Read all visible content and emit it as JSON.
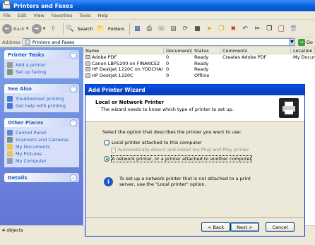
{
  "window": {
    "title": "Printers and Faxes"
  },
  "menu": [
    "File",
    "Edit",
    "View",
    "Favorites",
    "Tools",
    "Help"
  ],
  "toolbar": {
    "back": "Back",
    "search": "Search",
    "folders": "Folders"
  },
  "address": {
    "label": "Address",
    "value": "Printers and Faxes",
    "go": "Go"
  },
  "taskpane": {
    "printer_tasks": {
      "title": "Printer Tasks",
      "items": [
        "Add a printer",
        "Set up faxing"
      ]
    },
    "see_also": {
      "title": "See Also",
      "items": [
        "Troubleshoot printing",
        "Get help with printing"
      ]
    },
    "other_places": {
      "title": "Other Places",
      "items": [
        "Control Panel",
        "Scanners and Cameras",
        "My Documents",
        "My Pictures",
        "My Computer"
      ]
    },
    "details": {
      "title": "Details"
    }
  },
  "list": {
    "columns": [
      "Name",
      "Documents",
      "Status",
      "Comments",
      "Location"
    ],
    "rows": [
      [
        "Adobe PDF",
        "0",
        "Ready",
        "Creates Adobe PDF",
        "My Docum"
      ],
      [
        "Canon LBP5200 on FINANCE2",
        "0",
        "Ready",
        "",
        ""
      ],
      [
        "HP DeskJet 1220C on YODCHAI",
        "0",
        "Ready",
        "",
        ""
      ],
      [
        "HP DeskJet 1220C",
        "0",
        "Offline",
        "",
        ""
      ]
    ]
  },
  "status": {
    "text": "4 objects"
  },
  "wizard": {
    "title": "Add Printer Wizard",
    "heading": "Local or Network Printer",
    "subheading": "The wizard needs to know which type of printer to set up.",
    "prompt": "Select the option that describes the printer you want to use:",
    "option_local": "Local printer attached to this computer",
    "option_autodetect": "Automatically detect and install my Plug and Play printer",
    "option_network": "A network printer, or a printer attached to another computer",
    "info": "To set up a network printer that is not attached to a print server, use the \"Local printer\" option.",
    "back_label": "< Back",
    "next_label": "Next >",
    "cancel_label": "Cancel"
  }
}
